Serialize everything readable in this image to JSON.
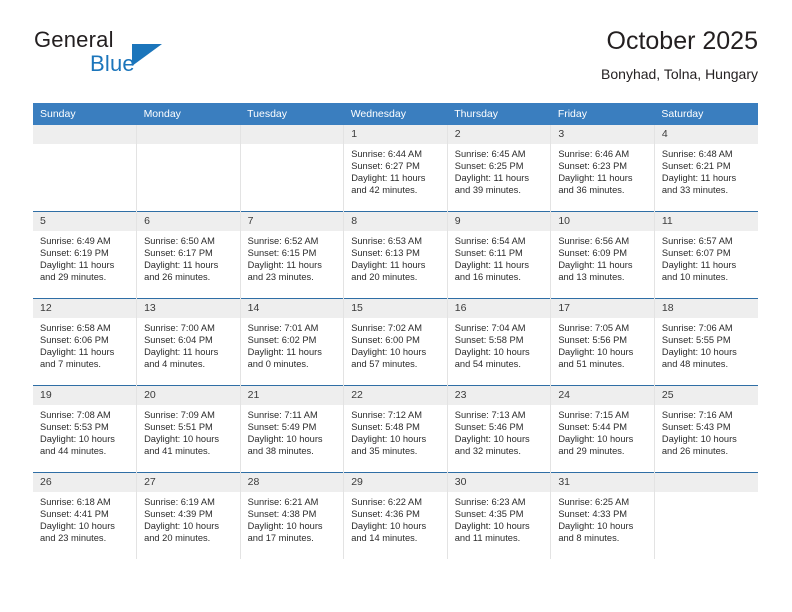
{
  "brand": {
    "word_one": "General",
    "word_two": "Blue",
    "logo_icon": "general-blue-triangle-icon",
    "accent_color": "#1b75bb"
  },
  "header": {
    "title": "October 2025",
    "subtitle": "Bonyhad, Tolna, Hungary"
  },
  "theme": {
    "header_row_color": "#3a7ebf",
    "day_number_bg": "#eeeeee",
    "row_separator_color": "#2f6ea5"
  },
  "calendar": {
    "weekday_headers": [
      "Sunday",
      "Monday",
      "Tuesday",
      "Wednesday",
      "Thursday",
      "Friday",
      "Saturday"
    ],
    "weeks": [
      [
        {
          "day": "",
          "empty": true,
          "sunrise": "",
          "sunset": "",
          "daylight1": "",
          "daylight2": ""
        },
        {
          "day": "",
          "empty": true,
          "sunrise": "",
          "sunset": "",
          "daylight1": "",
          "daylight2": ""
        },
        {
          "day": "",
          "empty": true,
          "sunrise": "",
          "sunset": "",
          "daylight1": "",
          "daylight2": ""
        },
        {
          "day": "1",
          "sunrise": "Sunrise: 6:44 AM",
          "sunset": "Sunset: 6:27 PM",
          "daylight1": "Daylight: 11 hours",
          "daylight2": "and 42 minutes."
        },
        {
          "day": "2",
          "sunrise": "Sunrise: 6:45 AM",
          "sunset": "Sunset: 6:25 PM",
          "daylight1": "Daylight: 11 hours",
          "daylight2": "and 39 minutes."
        },
        {
          "day": "3",
          "sunrise": "Sunrise: 6:46 AM",
          "sunset": "Sunset: 6:23 PM",
          "daylight1": "Daylight: 11 hours",
          "daylight2": "and 36 minutes."
        },
        {
          "day": "4",
          "sunrise": "Sunrise: 6:48 AM",
          "sunset": "Sunset: 6:21 PM",
          "daylight1": "Daylight: 11 hours",
          "daylight2": "and 33 minutes."
        }
      ],
      [
        {
          "day": "5",
          "sunrise": "Sunrise: 6:49 AM",
          "sunset": "Sunset: 6:19 PM",
          "daylight1": "Daylight: 11 hours",
          "daylight2": "and 29 minutes."
        },
        {
          "day": "6",
          "sunrise": "Sunrise: 6:50 AM",
          "sunset": "Sunset: 6:17 PM",
          "daylight1": "Daylight: 11 hours",
          "daylight2": "and 26 minutes."
        },
        {
          "day": "7",
          "sunrise": "Sunrise: 6:52 AM",
          "sunset": "Sunset: 6:15 PM",
          "daylight1": "Daylight: 11 hours",
          "daylight2": "and 23 minutes."
        },
        {
          "day": "8",
          "sunrise": "Sunrise: 6:53 AM",
          "sunset": "Sunset: 6:13 PM",
          "daylight1": "Daylight: 11 hours",
          "daylight2": "and 20 minutes."
        },
        {
          "day": "9",
          "sunrise": "Sunrise: 6:54 AM",
          "sunset": "Sunset: 6:11 PM",
          "daylight1": "Daylight: 11 hours",
          "daylight2": "and 16 minutes."
        },
        {
          "day": "10",
          "sunrise": "Sunrise: 6:56 AM",
          "sunset": "Sunset: 6:09 PM",
          "daylight1": "Daylight: 11 hours",
          "daylight2": "and 13 minutes."
        },
        {
          "day": "11",
          "sunrise": "Sunrise: 6:57 AM",
          "sunset": "Sunset: 6:07 PM",
          "daylight1": "Daylight: 11 hours",
          "daylight2": "and 10 minutes."
        }
      ],
      [
        {
          "day": "12",
          "sunrise": "Sunrise: 6:58 AM",
          "sunset": "Sunset: 6:06 PM",
          "daylight1": "Daylight: 11 hours",
          "daylight2": "and 7 minutes."
        },
        {
          "day": "13",
          "sunrise": "Sunrise: 7:00 AM",
          "sunset": "Sunset: 6:04 PM",
          "daylight1": "Daylight: 11 hours",
          "daylight2": "and 4 minutes."
        },
        {
          "day": "14",
          "sunrise": "Sunrise: 7:01 AM",
          "sunset": "Sunset: 6:02 PM",
          "daylight1": "Daylight: 11 hours",
          "daylight2": "and 0 minutes."
        },
        {
          "day": "15",
          "sunrise": "Sunrise: 7:02 AM",
          "sunset": "Sunset: 6:00 PM",
          "daylight1": "Daylight: 10 hours",
          "daylight2": "and 57 minutes."
        },
        {
          "day": "16",
          "sunrise": "Sunrise: 7:04 AM",
          "sunset": "Sunset: 5:58 PM",
          "daylight1": "Daylight: 10 hours",
          "daylight2": "and 54 minutes."
        },
        {
          "day": "17",
          "sunrise": "Sunrise: 7:05 AM",
          "sunset": "Sunset: 5:56 PM",
          "daylight1": "Daylight: 10 hours",
          "daylight2": "and 51 minutes."
        },
        {
          "day": "18",
          "sunrise": "Sunrise: 7:06 AM",
          "sunset": "Sunset: 5:55 PM",
          "daylight1": "Daylight: 10 hours",
          "daylight2": "and 48 minutes."
        }
      ],
      [
        {
          "day": "19",
          "sunrise": "Sunrise: 7:08 AM",
          "sunset": "Sunset: 5:53 PM",
          "daylight1": "Daylight: 10 hours",
          "daylight2": "and 44 minutes."
        },
        {
          "day": "20",
          "sunrise": "Sunrise: 7:09 AM",
          "sunset": "Sunset: 5:51 PM",
          "daylight1": "Daylight: 10 hours",
          "daylight2": "and 41 minutes."
        },
        {
          "day": "21",
          "sunrise": "Sunrise: 7:11 AM",
          "sunset": "Sunset: 5:49 PM",
          "daylight1": "Daylight: 10 hours",
          "daylight2": "and 38 minutes."
        },
        {
          "day": "22",
          "sunrise": "Sunrise: 7:12 AM",
          "sunset": "Sunset: 5:48 PM",
          "daylight1": "Daylight: 10 hours",
          "daylight2": "and 35 minutes."
        },
        {
          "day": "23",
          "sunrise": "Sunrise: 7:13 AM",
          "sunset": "Sunset: 5:46 PM",
          "daylight1": "Daylight: 10 hours",
          "daylight2": "and 32 minutes."
        },
        {
          "day": "24",
          "sunrise": "Sunrise: 7:15 AM",
          "sunset": "Sunset: 5:44 PM",
          "daylight1": "Daylight: 10 hours",
          "daylight2": "and 29 minutes."
        },
        {
          "day": "25",
          "sunrise": "Sunrise: 7:16 AM",
          "sunset": "Sunset: 5:43 PM",
          "daylight1": "Daylight: 10 hours",
          "daylight2": "and 26 minutes."
        }
      ],
      [
        {
          "day": "26",
          "sunrise": "Sunrise: 6:18 AM",
          "sunset": "Sunset: 4:41 PM",
          "daylight1": "Daylight: 10 hours",
          "daylight2": "and 23 minutes."
        },
        {
          "day": "27",
          "sunrise": "Sunrise: 6:19 AM",
          "sunset": "Sunset: 4:39 PM",
          "daylight1": "Daylight: 10 hours",
          "daylight2": "and 20 minutes."
        },
        {
          "day": "28",
          "sunrise": "Sunrise: 6:21 AM",
          "sunset": "Sunset: 4:38 PM",
          "daylight1": "Daylight: 10 hours",
          "daylight2": "and 17 minutes."
        },
        {
          "day": "29",
          "sunrise": "Sunrise: 6:22 AM",
          "sunset": "Sunset: 4:36 PM",
          "daylight1": "Daylight: 10 hours",
          "daylight2": "and 14 minutes."
        },
        {
          "day": "30",
          "sunrise": "Sunrise: 6:23 AM",
          "sunset": "Sunset: 4:35 PM",
          "daylight1": "Daylight: 10 hours",
          "daylight2": "and 11 minutes."
        },
        {
          "day": "31",
          "sunrise": "Sunrise: 6:25 AM",
          "sunset": "Sunset: 4:33 PM",
          "daylight1": "Daylight: 10 hours",
          "daylight2": "and 8 minutes."
        },
        {
          "day": "",
          "empty": true,
          "sunrise": "",
          "sunset": "",
          "daylight1": "",
          "daylight2": ""
        }
      ]
    ]
  }
}
